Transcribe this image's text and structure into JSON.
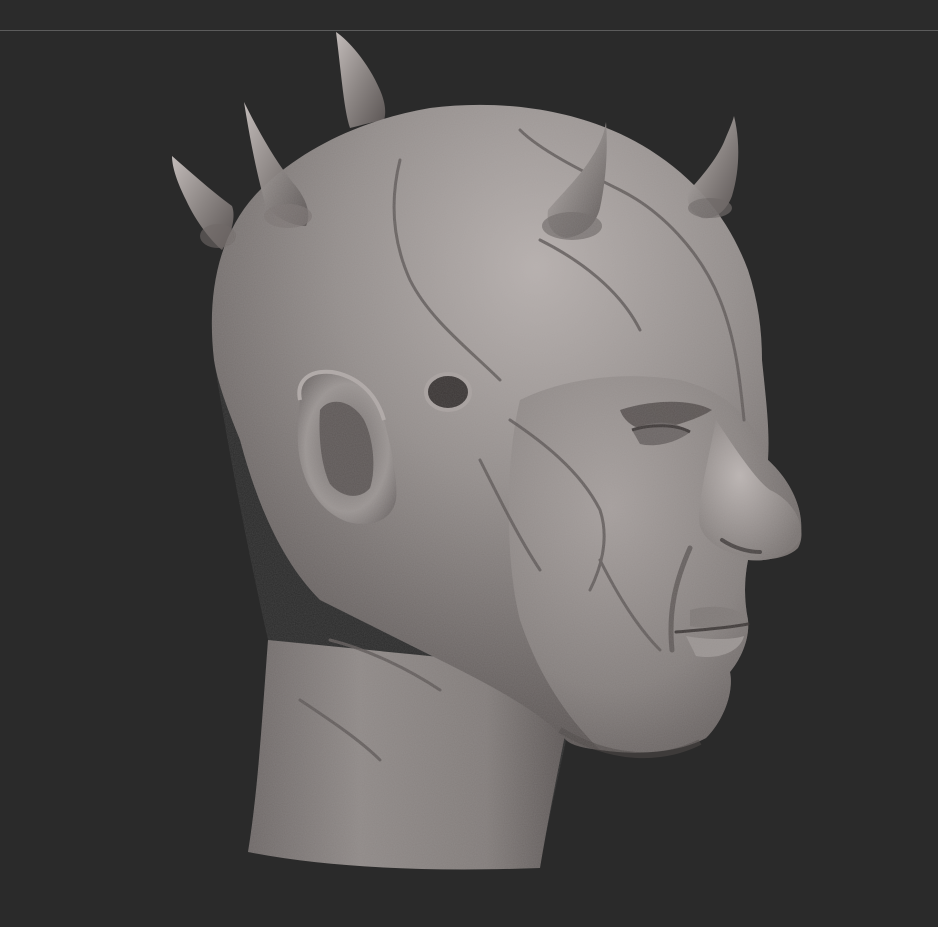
{
  "canvas": {
    "background": "#2a2a2a",
    "divider_color": "#5c5c5c",
    "model": {
      "subject": "sculpted-head-with-horns",
      "material_color": "#8e8887",
      "highlight_color": "#bdb6b4",
      "shadow_color": "#4a4544"
    }
  }
}
